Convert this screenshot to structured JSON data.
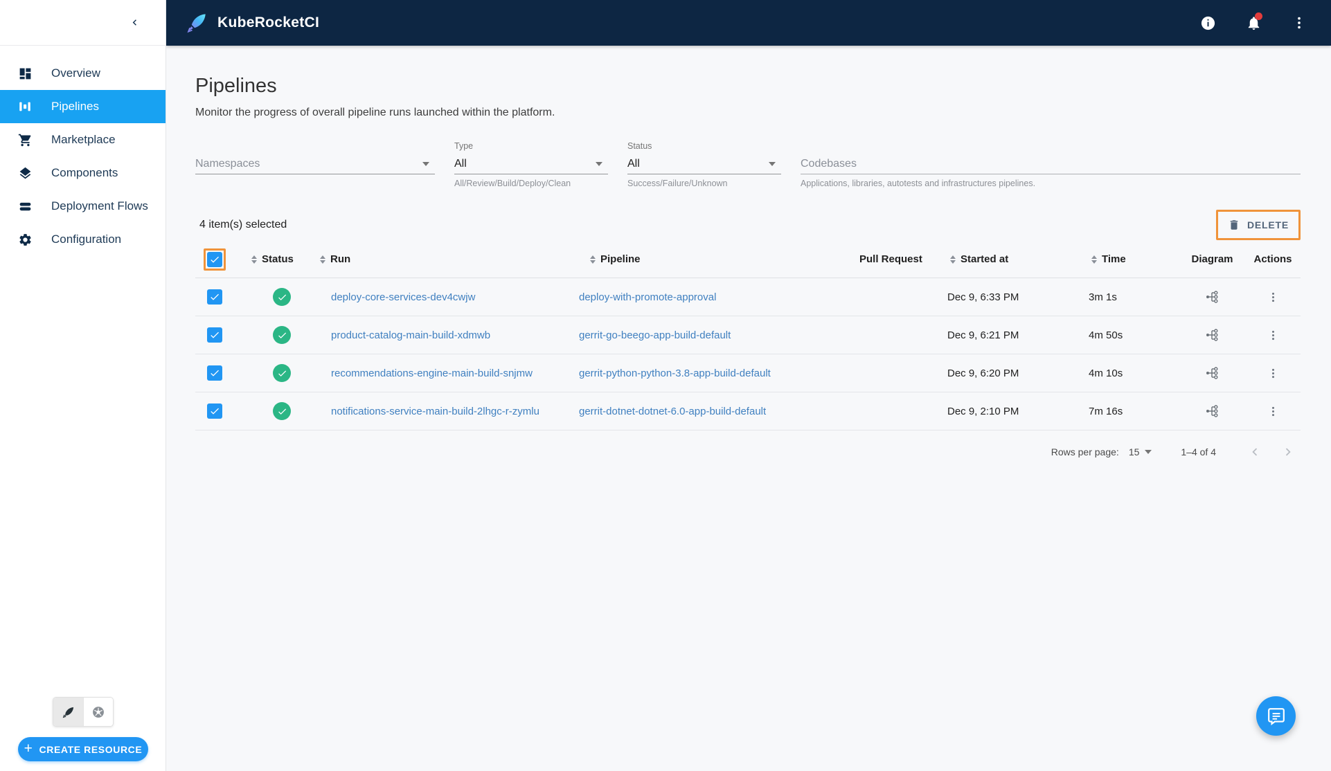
{
  "colors": {
    "header_bg": "#0d2643",
    "selected_blue": "#18a2f2",
    "accent": "#2196f3",
    "success": "#2bb685",
    "link": "#4080c0",
    "highlight": "#f0933a"
  },
  "header": {
    "app_title": "KubeRocketCI",
    "icons": [
      "info-icon",
      "notifications-bell-icon",
      "kebab-menu-icon"
    ]
  },
  "sidebar": {
    "items": [
      {
        "label": "Overview",
        "selected": false
      },
      {
        "label": "Pipelines",
        "selected": true
      },
      {
        "label": "Marketplace",
        "selected": false
      },
      {
        "label": "Components",
        "selected": false
      },
      {
        "label": "Deployment Flows",
        "selected": false
      },
      {
        "label": "Configuration",
        "selected": false
      }
    ],
    "create_button_label": "CREATE RESOURCE",
    "create_button_plus": "+"
  },
  "page": {
    "title": "Pipelines",
    "subtitle": "Monitor the progress of overall pipeline runs launched within the platform."
  },
  "filters": {
    "namespaces": {
      "placeholder": "Namespaces"
    },
    "type": {
      "label": "Type",
      "value": "All",
      "helper": "All/Review/Build/Deploy/Clean"
    },
    "status": {
      "label": "Status",
      "value": "All",
      "helper": "Success/Failure/Unknown"
    },
    "codebases": {
      "placeholder": "Codebases",
      "helper": "Applications, libraries, autotests and infrastructures pipelines."
    }
  },
  "selection": {
    "count_text": "4 item(s) selected",
    "delete_label": "DELETE"
  },
  "table": {
    "columns": {
      "status": "Status",
      "run": "Run",
      "pipeline": "Pipeline",
      "pull_request": "Pull Request",
      "started_at": "Started at",
      "time": "Time",
      "diagram": "Diagram",
      "actions": "Actions"
    },
    "rows": [
      {
        "status": "success",
        "selected": true,
        "run": "deploy-core-services-dev4cwjw",
        "pipeline": "deploy-with-promote-approval",
        "pull_request": "",
        "started": "Dec 9, 6:33 PM",
        "time": "3m 1s"
      },
      {
        "status": "success",
        "selected": true,
        "run": "product-catalog-main-build-xdmwb",
        "pipeline": "gerrit-go-beego-app-build-default",
        "pull_request": "",
        "started": "Dec 9, 6:21 PM",
        "time": "4m 50s"
      },
      {
        "status": "success",
        "selected": true,
        "run": "recommendations-engine-main-build-snjmw",
        "pipeline": "gerrit-python-python-3.8-app-build-default",
        "pull_request": "",
        "started": "Dec 9, 6:20 PM",
        "time": "4m 10s"
      },
      {
        "status": "success",
        "selected": true,
        "run": "notifications-service-main-build-2lhgc-r-zymlu",
        "pipeline": "gerrit-dotnet-dotnet-6.0-app-build-default",
        "pull_request": "",
        "started": "Dec 9, 2:10 PM",
        "time": "7m 16s"
      }
    ]
  },
  "pagination": {
    "rows_per_page_label": "Rows per page:",
    "rows_per_page_value": "15",
    "range_text": "1–4 of 4"
  }
}
